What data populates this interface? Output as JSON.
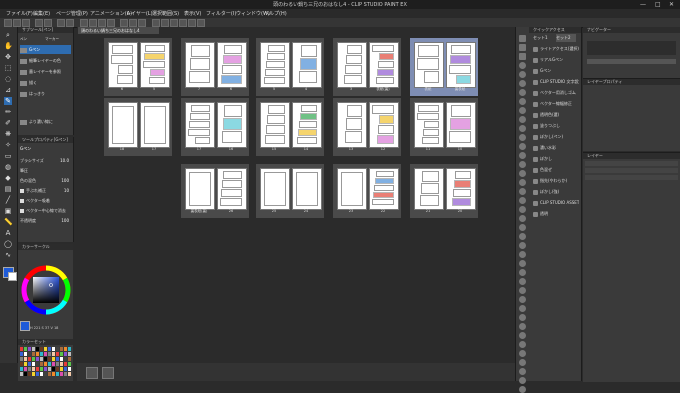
{
  "titlebar": {
    "title": "頭のわるい鍋ち三兄のおはなし4 - CLIP STUDIO PAINT EX",
    "minimize": "—",
    "maximize": "□",
    "close": "✕"
  },
  "menu": [
    "ファイル(F)",
    "編集(E)",
    "ページ管理(P)",
    "アニメーション(A)",
    "レイヤー(L)",
    "選択範囲(S)",
    "表示(V)",
    "フィルター(I)",
    "ウィンドウ(W)",
    "ヘルプ(H)"
  ],
  "document_tab": "頭のわるい鍋ち三兄のおはなし4",
  "subtool": {
    "header": "サブツール[ペン]",
    "tabs": [
      "ペン",
      "マーカー"
    ],
    "items": [
      "Gペン",
      "細筆レイヤーの色",
      "墨レイヤーを参照",
      "描く",
      "はっきり"
    ],
    "bottom_item": "より濃い線に"
  },
  "toolprop": {
    "header": "ツールプロパティ[Gペン]",
    "tool_name": "Gペン",
    "rows": [
      {
        "label": "ブラシサイズ",
        "value": "10.0"
      },
      {
        "label": "筆圧",
        "value": ""
      },
      {
        "label": "色の混色",
        "value": "100"
      },
      {
        "label": "手ぶれ補正",
        "value": "10"
      },
      {
        "label": "ベクター吸着",
        "value": ""
      },
      {
        "label": "ベクター中心線で消去",
        "value": ""
      },
      {
        "label": "不透明度",
        "value": "100"
      }
    ]
  },
  "colorpanel": {
    "header": "カラーサークル",
    "readout": "H 221 S 37 V 18"
  },
  "swatches": {
    "header": "カラーセット"
  },
  "spreads": [
    {
      "left": "6",
      "right": "5",
      "selected": false
    },
    {
      "left": "7",
      "right": "6",
      "selected": false
    },
    {
      "left": "5",
      "right": "4",
      "selected": false
    },
    {
      "left": "3",
      "right": "表紙(裏)",
      "selected": false
    },
    {
      "left": "表紙",
      "right": "裏表紙",
      "selected": true
    },
    {
      "left": "18",
      "right": "17",
      "selected": false
    },
    {
      "left": "17",
      "right": "16",
      "selected": false
    },
    {
      "left": "15",
      "right": "14",
      "selected": false
    },
    {
      "left": "13",
      "right": "12",
      "selected": false
    },
    {
      "left": "11",
      "right": "10",
      "selected": false
    },
    {
      "left": "裏表紙(裏)",
      "right": "26",
      "selected": false
    },
    {
      "left": "25",
      "right": "24",
      "selected": false
    },
    {
      "left": "23",
      "right": "22",
      "selected": false
    },
    {
      "left": "21",
      "right": "20",
      "selected": false
    }
  ],
  "quickaccess": {
    "header": "クイックアクセス",
    "tabs": [
      "セット1",
      "セット2"
    ],
    "items": [
      "ライトアクセス(選択)",
      "リアルGペン",
      "Gペン",
      "CLIP STUDIO 文字設定",
      "ベクター用消しゴム",
      "ベクター線幅修正",
      "透明色(選)",
      "塗りつぶし",
      "ぼかし(ペン)",
      "濃い水彩",
      "ぼかし",
      "色混ぜ",
      "指先(やわらか)",
      "ぼかし(強)",
      "CLIP STUDIO ASSETS",
      "透明"
    ]
  },
  "navpanel": {
    "header": "ナビゲーター"
  },
  "layerprop": {
    "header": "レイヤープロパティ"
  },
  "layerpanel": {
    "header": "レイヤー"
  }
}
